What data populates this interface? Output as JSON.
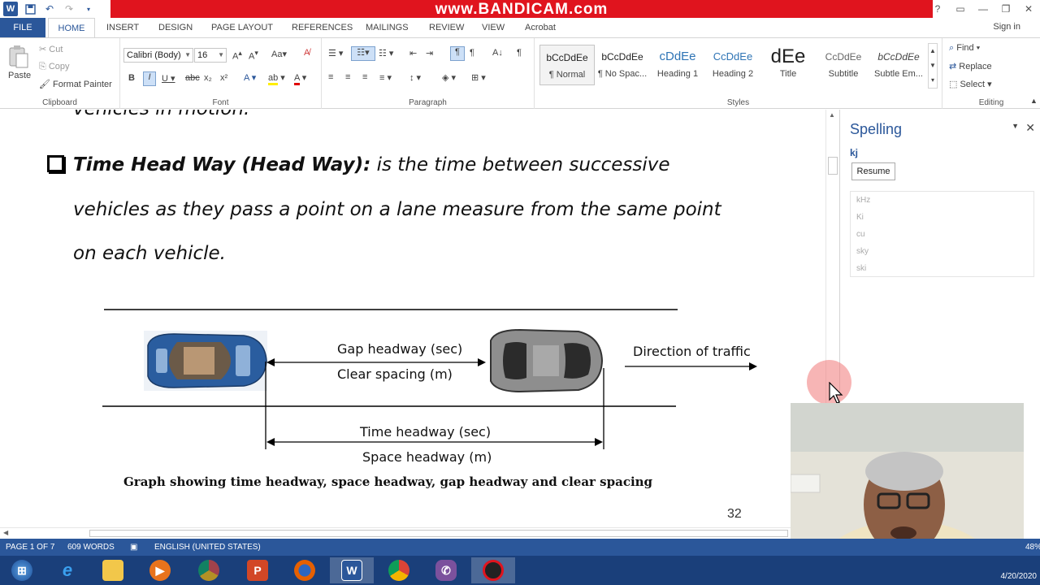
{
  "titlebar": {
    "recorder_text": "www.BANDICAM.com",
    "quick_access": [
      "word-logo-icon",
      "save-icon",
      "undo-icon",
      "redo-icon",
      "customize-icon"
    ],
    "window_controls": [
      "help-icon",
      "ribbon-display-icon",
      "minimize-icon",
      "restore-icon",
      "close-icon"
    ]
  },
  "tabs": {
    "file": "FILE",
    "items": [
      "HOME",
      "INSERT",
      "DESIGN",
      "PAGE LAYOUT",
      "REFERENCES",
      "MAILINGS",
      "REVIEW",
      "VIEW",
      "Acrobat"
    ],
    "active": "HOME",
    "sign_in": "Sign in"
  },
  "ribbon": {
    "clipboard": {
      "label": "Clipboard",
      "paste": "Paste",
      "cut": "Cut",
      "copy": "Copy",
      "format_painter": "Format Painter"
    },
    "font": {
      "label": "Font",
      "font_name": "Calibri (Body)",
      "font_size": "16"
    },
    "paragraph": {
      "label": "Paragraph"
    },
    "styles": {
      "label": "Styles",
      "items": [
        {
          "preview": "bCcDdEe",
          "name": "¶ Normal"
        },
        {
          "preview": "bCcDdEe",
          "name": "¶ No Spac..."
        },
        {
          "preview": "cDdEe",
          "name": "Heading 1"
        },
        {
          "preview": "CcDdEe",
          "name": "Heading 2"
        },
        {
          "preview": "dEe",
          "name": "Title"
        },
        {
          "preview": "CcDdEe",
          "name": "Subtitle"
        },
        {
          "preview": "bCcDdEe",
          "name": "Subtle Em..."
        }
      ]
    },
    "editing": {
      "label": "Editing",
      "find": "Find",
      "replace": "Replace",
      "select": "Select"
    }
  },
  "document": {
    "prev_line": "vehicles in motion.",
    "bullet_title": "Time Head Way (Head Way):",
    "line1": " is the time between successive",
    "line2": "vehicles as they pass a point on a lane measure from the same point",
    "line3": "on each vehicle.",
    "figure": {
      "gap_headway": "Gap headway (sec)",
      "clear_spacing": "Clear spacing (m)",
      "direction": "Direction of traffic",
      "time_headway": "Time headway (sec)",
      "space_headway": "Space headway (m)"
    },
    "caption": "Graph showing time headway, space headway, gap headway and clear spacing",
    "page_number": "32"
  },
  "spelling_pane": {
    "title": "Spelling",
    "word": "kj",
    "resume": "Resume",
    "suggestions": [
      "kHz",
      "Ki",
      "cu",
      "sky",
      "ski"
    ]
  },
  "status": {
    "page": "PAGE 1 OF 7",
    "words": "609 WORDS",
    "language": "ENGLISH (UNITED STATES)",
    "zoom": "48%"
  },
  "taskbar": {
    "date": "4/20/2020",
    "apps": [
      "start-icon",
      "ie-icon",
      "explorer-icon",
      "media-player-icon",
      "chrome-icon",
      "powerpoint-icon",
      "firefox-icon",
      "word-icon",
      "chrome-icon",
      "viber-icon",
      "bandicam-icon"
    ]
  },
  "colors": {
    "accent": "#2b579a",
    "recorder_bar": "#e0141e",
    "taskbar": "#1a3f7a"
  }
}
